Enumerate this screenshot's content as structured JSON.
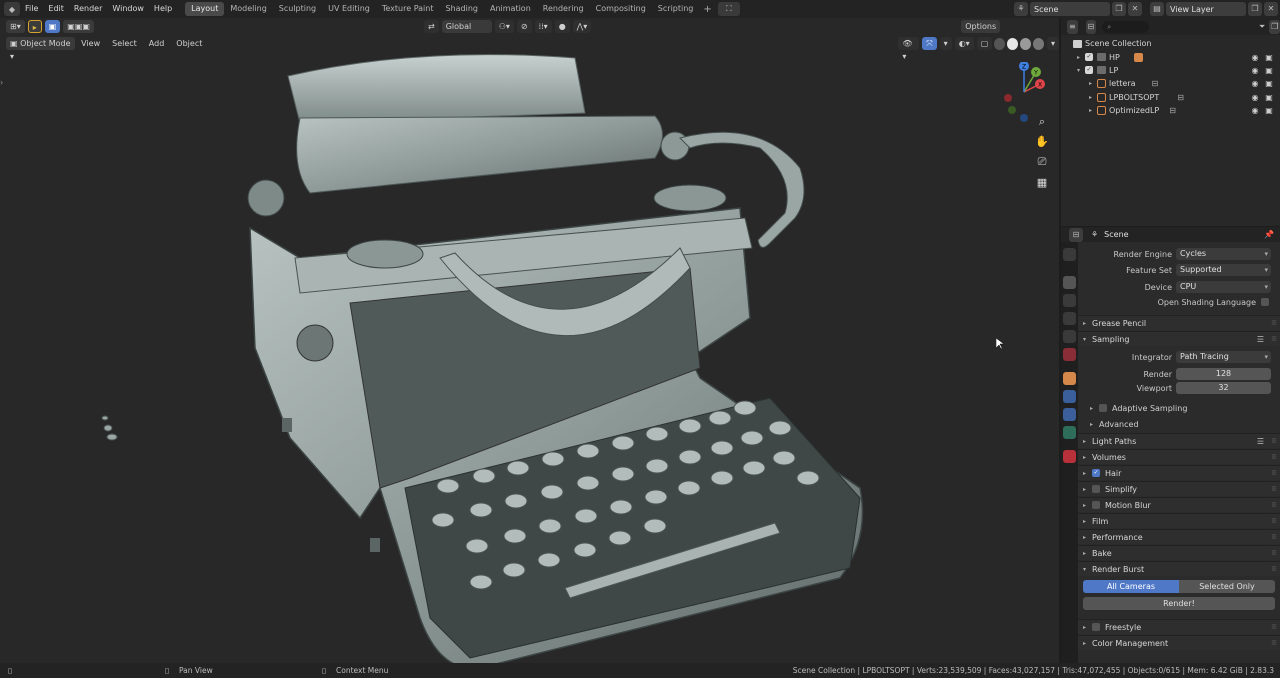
{
  "menubar": {
    "items": [
      "File",
      "Edit",
      "Render",
      "Window",
      "Help"
    ],
    "workspaces": [
      "Layout",
      "Modeling",
      "Sculpting",
      "UV Editing",
      "Texture Paint",
      "Shading",
      "Animation",
      "Rendering",
      "Compositing",
      "Scripting"
    ],
    "active_workspace": "Layout",
    "scene_name": "Scene",
    "view_layer": "View Layer"
  },
  "viewport": {
    "mode": "Object Mode",
    "menus": [
      "View",
      "Select",
      "Add",
      "Object"
    ],
    "transform_orientation": "Global",
    "options_label": "Options",
    "gizmo": {
      "x": "X",
      "y": "Y",
      "z": "Z"
    }
  },
  "outliner": {
    "root": "Scene Collection",
    "items": [
      {
        "name": "HP",
        "level": 1
      },
      {
        "name": "LP",
        "level": 1
      },
      {
        "name": "lettera",
        "level": 2
      },
      {
        "name": "LPBOLTSOPT",
        "level": 2
      },
      {
        "name": "OptimizedLP",
        "level": 2
      }
    ]
  },
  "properties": {
    "context": "Scene",
    "render_engine_label": "Render Engine",
    "render_engine": "Cycles",
    "feature_set_label": "Feature Set",
    "feature_set": "Supported",
    "device_label": "Device",
    "device": "CPU",
    "osl_label": "Open Shading Language",
    "panels": {
      "grease_pencil": "Grease Pencil",
      "sampling": "Sampling",
      "integrator_label": "Integrator",
      "integrator": "Path Tracing",
      "render_label": "Render",
      "render_samples": "128",
      "viewport_label": "Viewport",
      "viewport_samples": "32",
      "adaptive_sampling": "Adaptive Sampling",
      "advanced": "Advanced",
      "light_paths": "Light Paths",
      "volumes": "Volumes",
      "hair": "Hair",
      "simplify": "Simplify",
      "motion_blur": "Motion Blur",
      "film": "Film",
      "performance": "Performance",
      "bake": "Bake",
      "render_burst": "Render Burst",
      "all_cameras": "All Cameras",
      "selected_only": "Selected Only",
      "render_button": "Render!",
      "freestyle": "Freestyle",
      "color_management": "Color Management"
    }
  },
  "statusbar": {
    "pan_view": "Pan View",
    "context_menu": "Context Menu",
    "stats": "Scene Collection | LPBOLTSOPT | Verts:23,539,509 | Faces:43,027,157 | Tris:47,072,455 | Objects:0/615 | Mem: 6.42 GiB | 2.83.3"
  },
  "colors": {
    "accent": "#4f78c7",
    "axis_x": "#e0454a",
    "axis_y": "#6fa83c",
    "axis_z": "#3f7fe0",
    "model": "#9aa7a5"
  }
}
